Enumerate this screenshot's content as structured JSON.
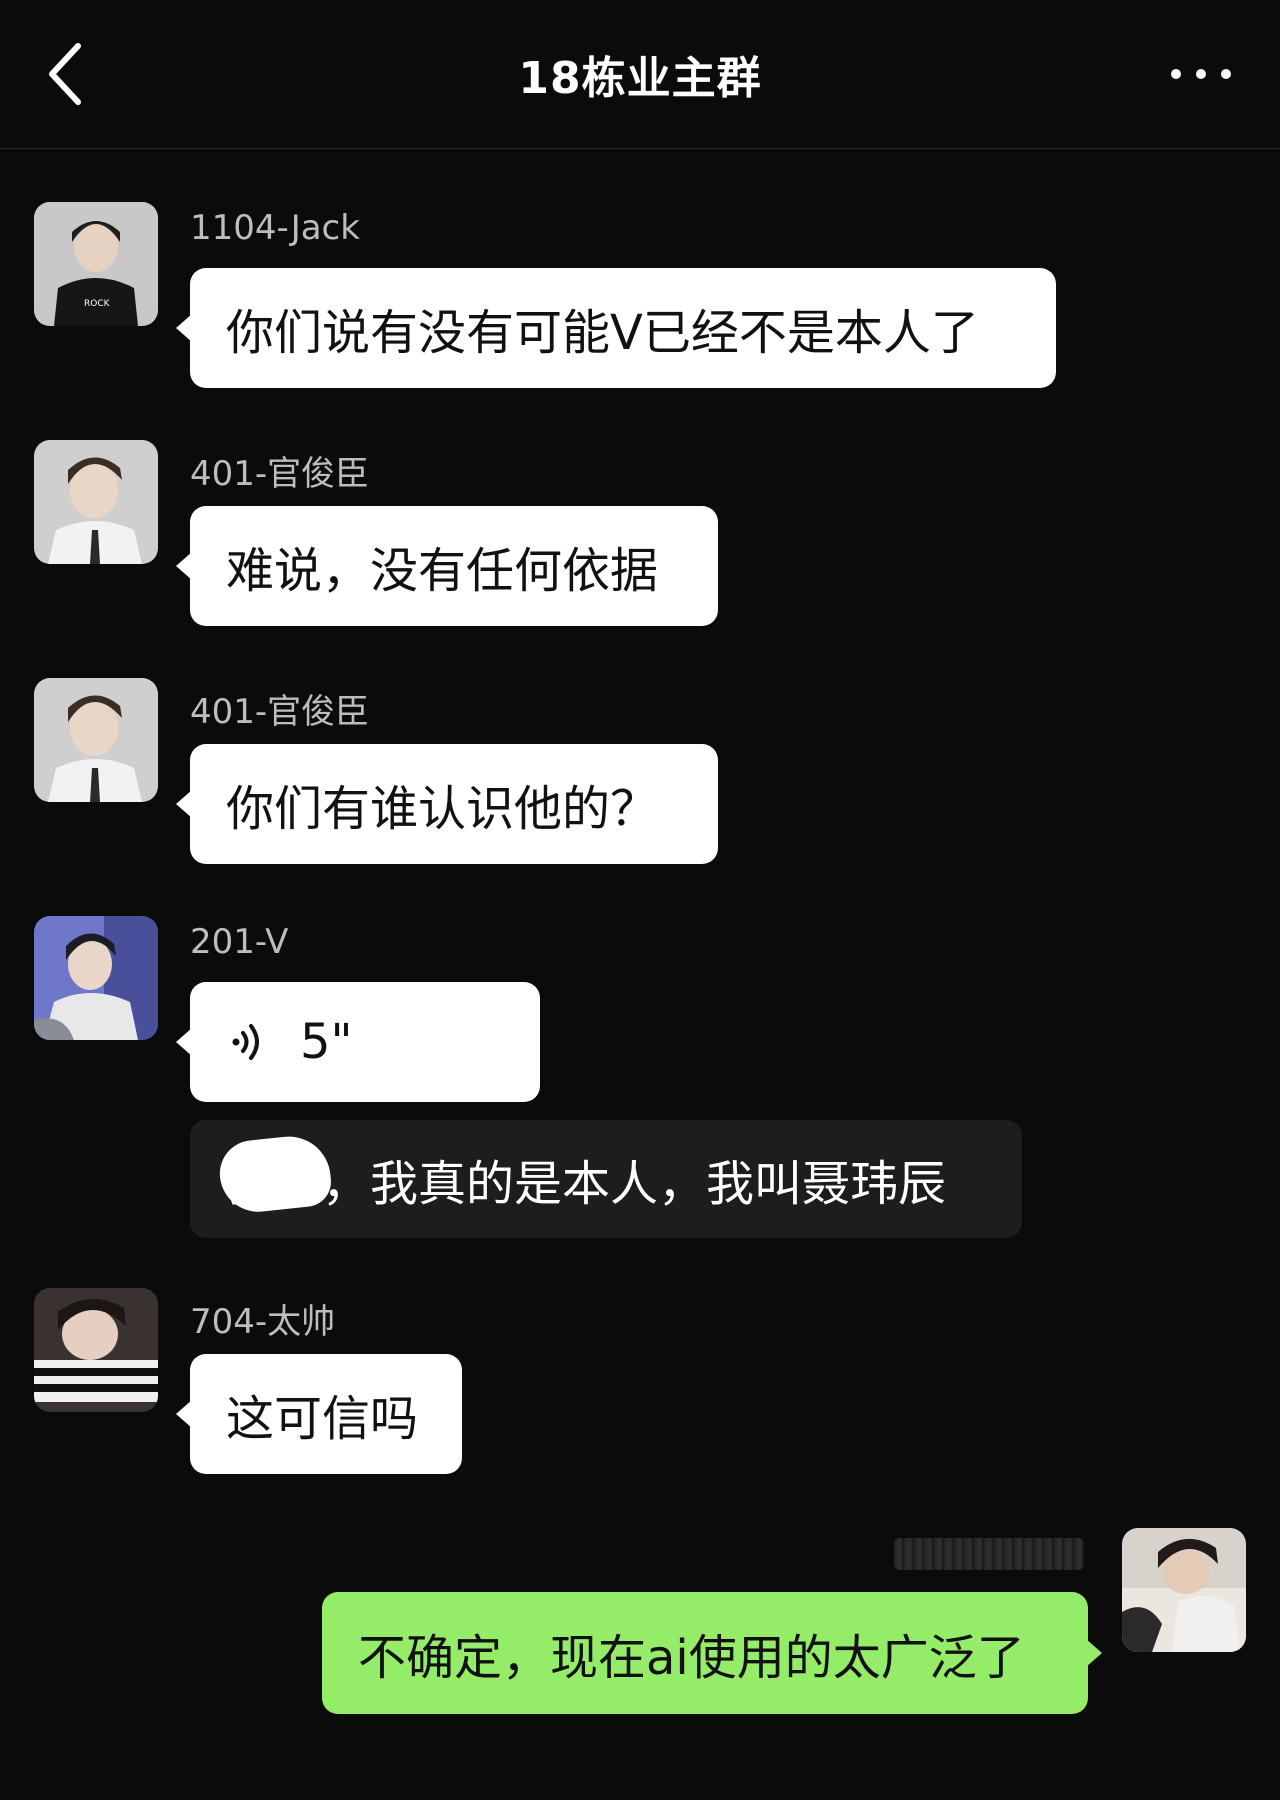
{
  "header": {
    "title": "18栋业主群",
    "back_icon": "chevron-left-icon",
    "more_icon": "ellipsis-icon"
  },
  "messages": [
    {
      "sender": "1104-Jack",
      "text": "你们说有没有可能V已经不是本人了",
      "type": "text"
    },
    {
      "sender": "401-官俊臣",
      "text": "难说，没有任何依据",
      "type": "text"
    },
    {
      "sender": "401-官俊臣",
      "text": "你们有谁认识他的？",
      "type": "text"
    },
    {
      "sender": "201-V",
      "voice_duration": "5\"",
      "transcript": "我靠，我真的是本人，我叫聂玮辰",
      "type": "voice"
    },
    {
      "sender": "704-太帅",
      "text": "这可信吗",
      "type": "text"
    },
    {
      "sender": "",
      "text": "不确定，现在ai使用的太广泛了",
      "type": "self"
    }
  ],
  "colors": {
    "background": "#0b0b0b",
    "incoming_bubble": "#ffffff",
    "outgoing_bubble": "#95ec69",
    "transcript_bubble": "#1d1d1d"
  }
}
